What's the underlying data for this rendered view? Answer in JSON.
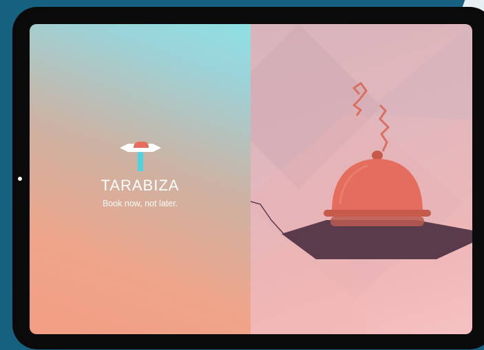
{
  "app": {
    "brand_name": "TARABIZA",
    "tagline": "Book now, not later."
  },
  "colors": {
    "background": "#16617f",
    "tablet_frame": "#0a0a0a",
    "cloche": "#e46d5d",
    "tray": "#5a3b4c",
    "steam": "#d9705f",
    "logo_handle": "#4fd3e0"
  },
  "icons": {
    "logo": "serving-tray-icon",
    "illustration": "cloche-dish-illustration"
  }
}
